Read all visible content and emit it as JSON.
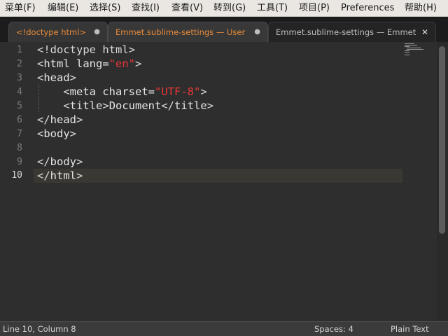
{
  "menu": {
    "items": [
      "菜单(F)",
      "编辑(E)",
      "选择(S)",
      "查找(I)",
      "查看(V)",
      "转到(G)",
      "工具(T)",
      "项目(P)",
      "Preferences",
      "帮助(H)"
    ]
  },
  "tabs": [
    {
      "label": "<!doctype html>",
      "control": "●",
      "state": "active-unsaved"
    },
    {
      "label": "Emmet.sublime-settings — User",
      "control": "●",
      "state": "unsaved"
    },
    {
      "label": "Emmet.sublime-settings — Emmet",
      "control": "✕",
      "state": "inactive"
    }
  ],
  "editor": {
    "line_numbers": [
      "1",
      "2",
      "3",
      "4",
      "5",
      "6",
      "7",
      "8",
      "9",
      "10"
    ],
    "current_line": "10",
    "lines": [
      [
        {
          "t": "<!doctype html>",
          "c": "punct"
        }
      ],
      [
        {
          "t": "<",
          "c": "punct"
        },
        {
          "t": "html",
          "c": "tag"
        },
        {
          "t": " lang=",
          "c": "attr"
        },
        {
          "t": "\"en\"",
          "c": "str"
        },
        {
          "t": ">",
          "c": "punct"
        }
      ],
      [
        {
          "t": "<",
          "c": "punct"
        },
        {
          "t": "head",
          "c": "tag"
        },
        {
          "t": ">",
          "c": "punct"
        }
      ],
      [
        {
          "t": "    <",
          "c": "punct"
        },
        {
          "t": "meta",
          "c": "tag"
        },
        {
          "t": " charset=",
          "c": "attr"
        },
        {
          "t": "\"UTF-8\"",
          "c": "str"
        },
        {
          "t": ">",
          "c": "punct"
        }
      ],
      [
        {
          "t": "    <",
          "c": "punct"
        },
        {
          "t": "title",
          "c": "tag"
        },
        {
          "t": ">",
          "c": "punct"
        },
        {
          "t": "Document",
          "c": "text"
        },
        {
          "t": "</",
          "c": "punct"
        },
        {
          "t": "title",
          "c": "tag"
        },
        {
          "t": ">",
          "c": "punct"
        }
      ],
      [
        {
          "t": "</",
          "c": "punct"
        },
        {
          "t": "head",
          "c": "tag"
        },
        {
          "t": ">",
          "c": "punct"
        }
      ],
      [
        {
          "t": "<",
          "c": "punct"
        },
        {
          "t": "body",
          "c": "tag"
        },
        {
          "t": ">",
          "c": "punct"
        }
      ],
      [],
      [
        {
          "t": "</",
          "c": "punct"
        },
        {
          "t": "body",
          "c": "tag"
        },
        {
          "t": ">",
          "c": "punct"
        }
      ],
      [
        {
          "t": "</",
          "c": "punct"
        },
        {
          "t": "html",
          "c": "tag"
        },
        {
          "t": ">",
          "c": "punct"
        }
      ]
    ]
  },
  "status": {
    "position": "Line 10, Column 8",
    "indentation": "Spaces: 4",
    "syntax": "Plain Text"
  },
  "colors": {
    "tab_modified": "#e98c3c",
    "string": "#e8373a",
    "background": "#2e2e2e"
  }
}
